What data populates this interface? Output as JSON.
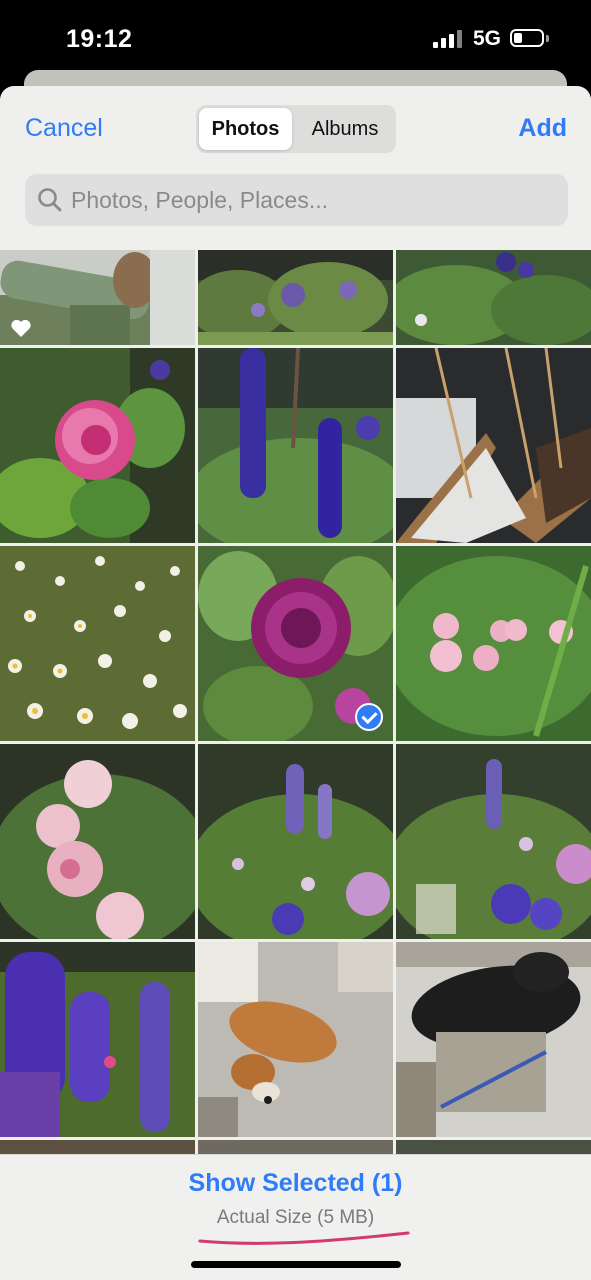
{
  "status_bar": {
    "time": "19:12",
    "network": "5G"
  },
  "header": {
    "cancel_label": "Cancel",
    "add_label": "Add",
    "tabs": [
      "Photos",
      "Albums"
    ],
    "active_tab": "Photos"
  },
  "search": {
    "placeholder": "Photos, People, Places..."
  },
  "grid": {
    "photos": [
      {
        "subject": "green garden cane close-up",
        "favorite": true,
        "selected": false
      },
      {
        "subject": "garden border with purple flowers",
        "favorite": false,
        "selected": false
      },
      {
        "subject": "garden plants with purple flowers",
        "favorite": false,
        "selected": false
      },
      {
        "subject": "pink striped rose",
        "favorite": false,
        "selected": false
      },
      {
        "subject": "purple delphiniums",
        "favorite": false,
        "selected": false
      },
      {
        "subject": "raised beds with canes",
        "favorite": false,
        "selected": false
      },
      {
        "subject": "white daisies",
        "favorite": false,
        "selected": false
      },
      {
        "subject": "purple rose",
        "favorite": false,
        "selected": true
      },
      {
        "subject": "pink roses in foliage",
        "favorite": false,
        "selected": false
      },
      {
        "subject": "pink striped roses",
        "favorite": false,
        "selected": false
      },
      {
        "subject": "purple flower border",
        "favorite": false,
        "selected": false
      },
      {
        "subject": "purple flowers and alliums",
        "favorite": false,
        "selected": false
      },
      {
        "subject": "purple delphinium spikes",
        "favorite": false,
        "selected": false
      },
      {
        "subject": "dog lying on carpet",
        "favorite": false,
        "selected": false
      },
      {
        "subject": "black dog sleeping",
        "favorite": false,
        "selected": false
      }
    ]
  },
  "footer": {
    "show_selected_label": "Show Selected (1)",
    "size_label": "Actual Size (5 MB)"
  },
  "colors": {
    "accent": "#2f7cf6",
    "annotation_underline": "#d23a6e"
  }
}
